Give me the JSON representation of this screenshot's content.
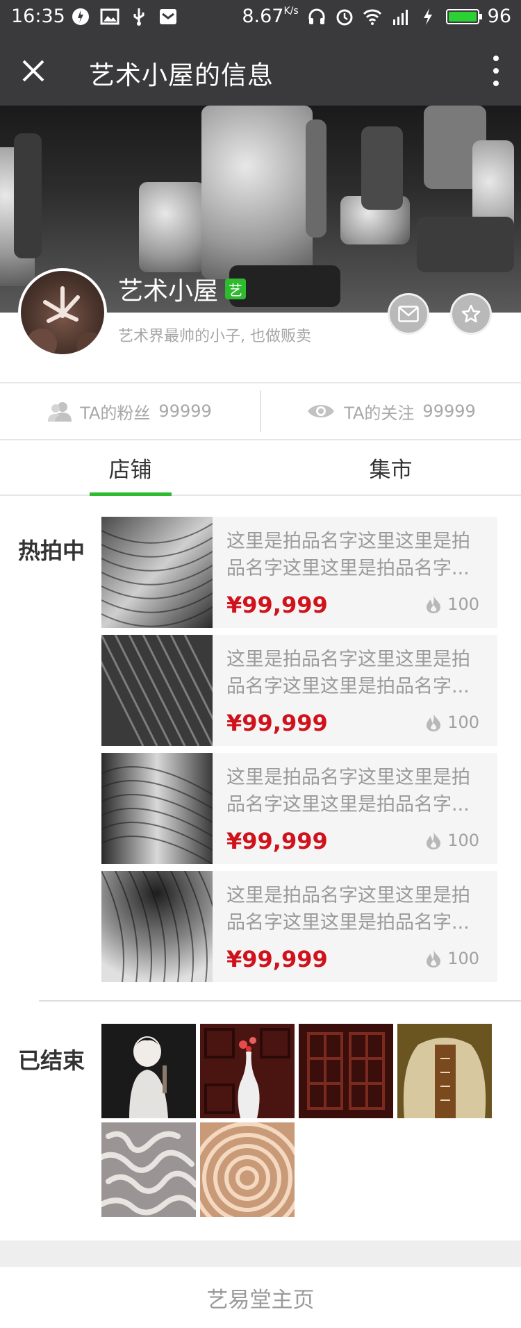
{
  "status_bar": {
    "time": "16:35",
    "net_speed": "8.67",
    "net_unit": "K/s",
    "battery": "96",
    "battery_color": "#2bd134"
  },
  "nav": {
    "title": "艺术小屋的信息",
    "close_icon": "close-icon",
    "more_icon": "more-vertical-icon"
  },
  "profile": {
    "name": "艺术小屋",
    "badge": "艺",
    "badge_color": "#2fbb2f",
    "bio": "艺术界最帅的小子, 也做贩卖"
  },
  "stats": {
    "followers_label": "TA的粉丝",
    "followers_count": "99999",
    "following_label": "TA的关注",
    "following_count": "99999"
  },
  "tabs": [
    {
      "label": "店铺",
      "active": true
    },
    {
      "label": "集市",
      "active": false
    }
  ],
  "hot_section": {
    "label": "热拍中",
    "items": [
      {
        "name": "这里是拍品名字这里这里是拍品名字这里这里是拍品名字...",
        "price": "¥99,999",
        "heat": "100"
      },
      {
        "name": "这里是拍品名字这里这里是拍品名字这里这里是拍品名字...",
        "price": "¥99,999",
        "heat": "100"
      },
      {
        "name": "这里是拍品名字这里这里是拍品名字这里这里是拍品名字...",
        "price": "¥99,999",
        "heat": "100"
      },
      {
        "name": "这里是拍品名字这里这里是拍品名字这里这里是拍品名字...",
        "price": "¥99,999",
        "heat": "100"
      }
    ]
  },
  "ended_section": {
    "label": "已结束",
    "count": 6
  },
  "footer": {
    "link": "艺易堂主页"
  },
  "accent_color": "#2fbb2f",
  "price_color": "#d0121c"
}
